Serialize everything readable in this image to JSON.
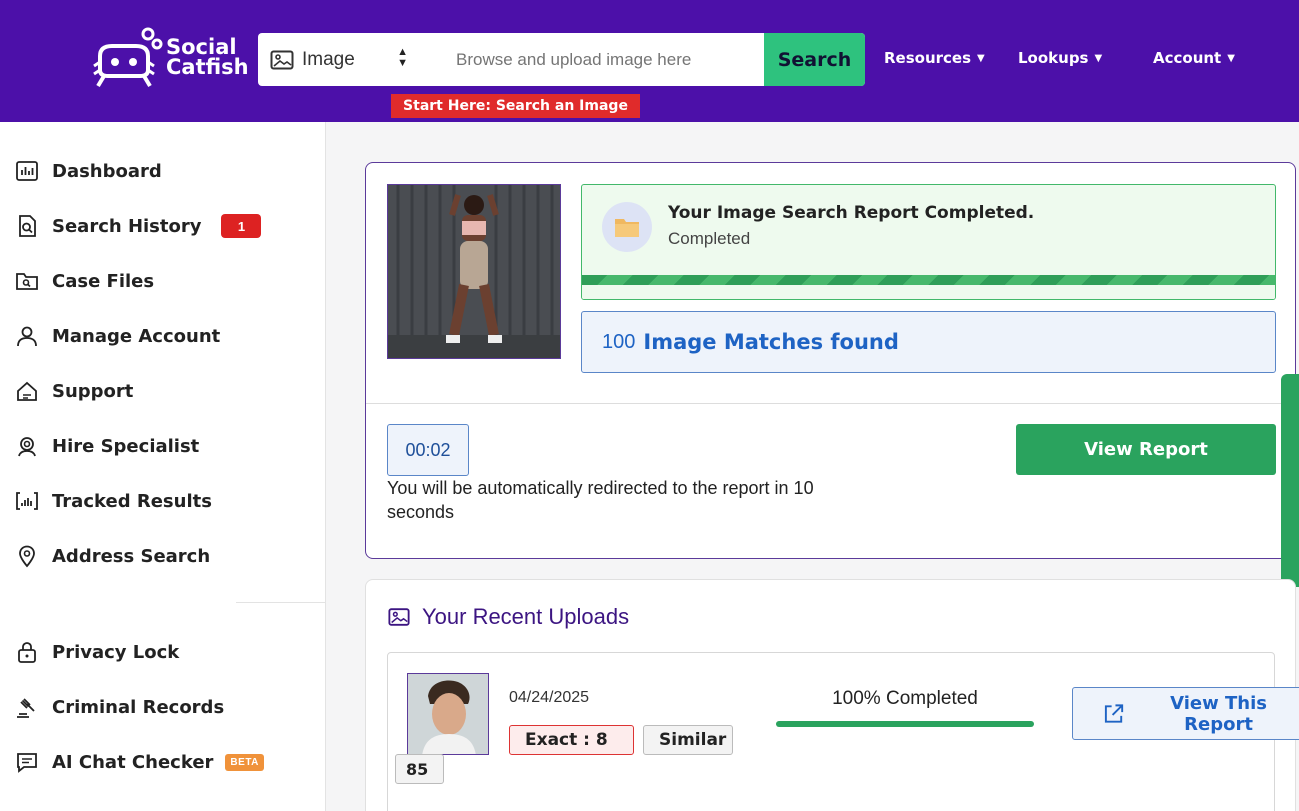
{
  "header": {
    "logo_line1": "Social",
    "logo_line2": "Catfish",
    "search_type": "Image",
    "upload_placeholder": "Browse and upload image here",
    "search_button": "Search",
    "start_here": "Start Here: Search an Image",
    "nav": [
      "Resources",
      "Lookups",
      "Account"
    ],
    "brand_color": "#4c10a9"
  },
  "sidebar": {
    "items": [
      {
        "label": "Dashboard",
        "icon": "chart-icon"
      },
      {
        "label": "Search History",
        "icon": "history-icon",
        "badge": "1"
      },
      {
        "label": "Case Files",
        "icon": "folder-search-icon"
      },
      {
        "label": "Manage Account",
        "icon": "user-icon"
      },
      {
        "label": "Support",
        "icon": "support-icon"
      },
      {
        "label": "Hire Specialist",
        "icon": "specialist-icon"
      },
      {
        "label": "Tracked Results",
        "icon": "tracked-icon"
      },
      {
        "label": "Address Search",
        "icon": "location-pin-icon"
      },
      {
        "label": "Privacy Lock",
        "icon": "lock-icon"
      },
      {
        "label": "Criminal Records",
        "icon": "gavel-icon"
      },
      {
        "label": "AI Chat Checker",
        "icon": "chat-icon",
        "badge": "BETA"
      }
    ]
  },
  "report": {
    "status_title": "Your Image Search Report Completed.",
    "status_sub": "Completed",
    "progress": 1.0,
    "matches_count": "100",
    "matches_label": "Image Matches found",
    "timer": "00:02",
    "redirect_text": "You will be automatically redirected to the report in 10 seconds",
    "view_report": "View Report"
  },
  "recent": {
    "title": "Your Recent Uploads",
    "uploads": [
      {
        "date": "04/24/2025",
        "exact": "Exact : 8",
        "similar": "Similar :",
        "similar_count": "85",
        "percent_label": "100% Completed",
        "percent": 1.0,
        "view_button": "View This Report"
      }
    ]
  }
}
